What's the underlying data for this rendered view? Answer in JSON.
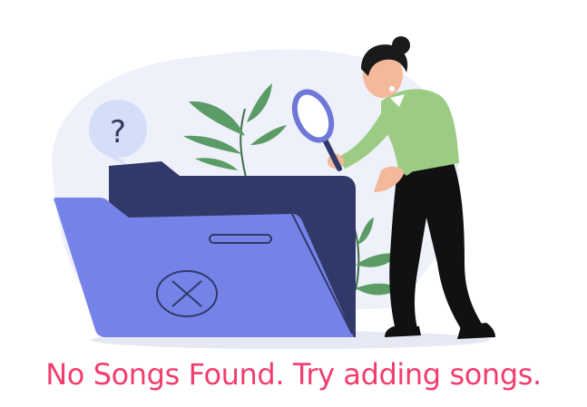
{
  "empty_state": {
    "message": "No Songs Found. Try adding songs.",
    "message_color": "#f23d6d",
    "illustration": {
      "subject": "person searching folder with magnifying glass",
      "icons": [
        "question-mark-bubble-icon",
        "folder-icon",
        "x-circle-icon",
        "magnifying-glass-icon",
        "plant-icon"
      ]
    }
  },
  "colors": {
    "background_blob": "#eef0fa",
    "folder_back": "#313968",
    "folder_front": "#7583e8",
    "shirt": "#9ccc84",
    "pants": "#111111",
    "skin": "#f4b99a",
    "leaf": "#5b9b66",
    "bubble": "#d5def8"
  }
}
